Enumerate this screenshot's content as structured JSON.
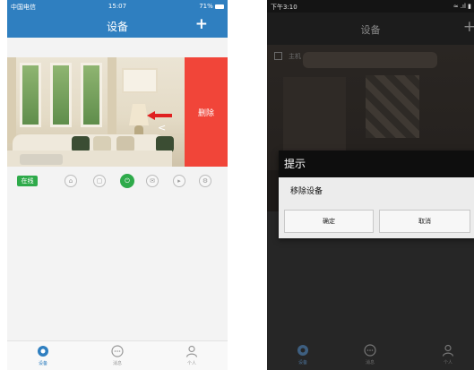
{
  "left": {
    "status_bar": {
      "carrier": "中国电信",
      "time": "15:07",
      "battery": "71%"
    },
    "header": {
      "title": "设备",
      "add": "+"
    },
    "device": {
      "delete_label": "删除",
      "status": "在线"
    },
    "controls": [
      {
        "icon": "home-icon"
      },
      {
        "icon": "lock-icon"
      },
      {
        "icon": "power-icon",
        "active": true
      },
      {
        "icon": "mail-icon"
      },
      {
        "icon": "play-icon"
      },
      {
        "icon": "settings-icon"
      }
    ],
    "tabs": [
      {
        "label": "设备",
        "icon": "device-icon",
        "selected": true
      },
      {
        "label": "消息",
        "icon": "message-icon"
      },
      {
        "label": "个人",
        "icon": "person-icon"
      }
    ]
  },
  "right": {
    "status_bar": {
      "time": "下午3:10"
    },
    "header": {
      "title": "设备",
      "add": "+"
    },
    "host_label": "主机",
    "dialog": {
      "title": "提示",
      "message": "移除设备",
      "confirm": "确定",
      "cancel": "取消"
    },
    "tabs": [
      {
        "label": "设备",
        "icon": "device-icon",
        "selected": true
      },
      {
        "label": "消息",
        "icon": "message-icon"
      },
      {
        "label": "个人",
        "icon": "person-icon"
      }
    ]
  },
  "colors": {
    "primary_blue": "#2f7fc0",
    "delete_red": "#f14539",
    "online_green": "#2eaa4a",
    "dialog_title_bg": "#0e0e0e"
  }
}
